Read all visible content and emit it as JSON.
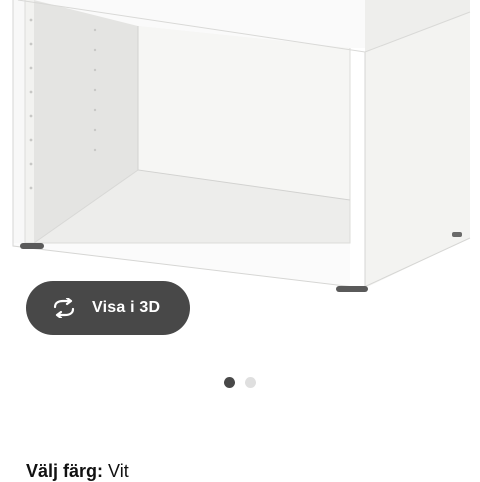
{
  "product": {
    "image_alt": "White shelf unit",
    "view3d_label": "Visa i 3D",
    "view3d_icon": "rotate-3d-icon"
  },
  "carousel": {
    "total": 2,
    "active": 1
  },
  "color": {
    "label": "Välj färg:",
    "value": "Vit"
  },
  "colors": {
    "button_bg": "#484848",
    "dot_active": "#484848",
    "dot_inactive": "#dfdfdf"
  }
}
